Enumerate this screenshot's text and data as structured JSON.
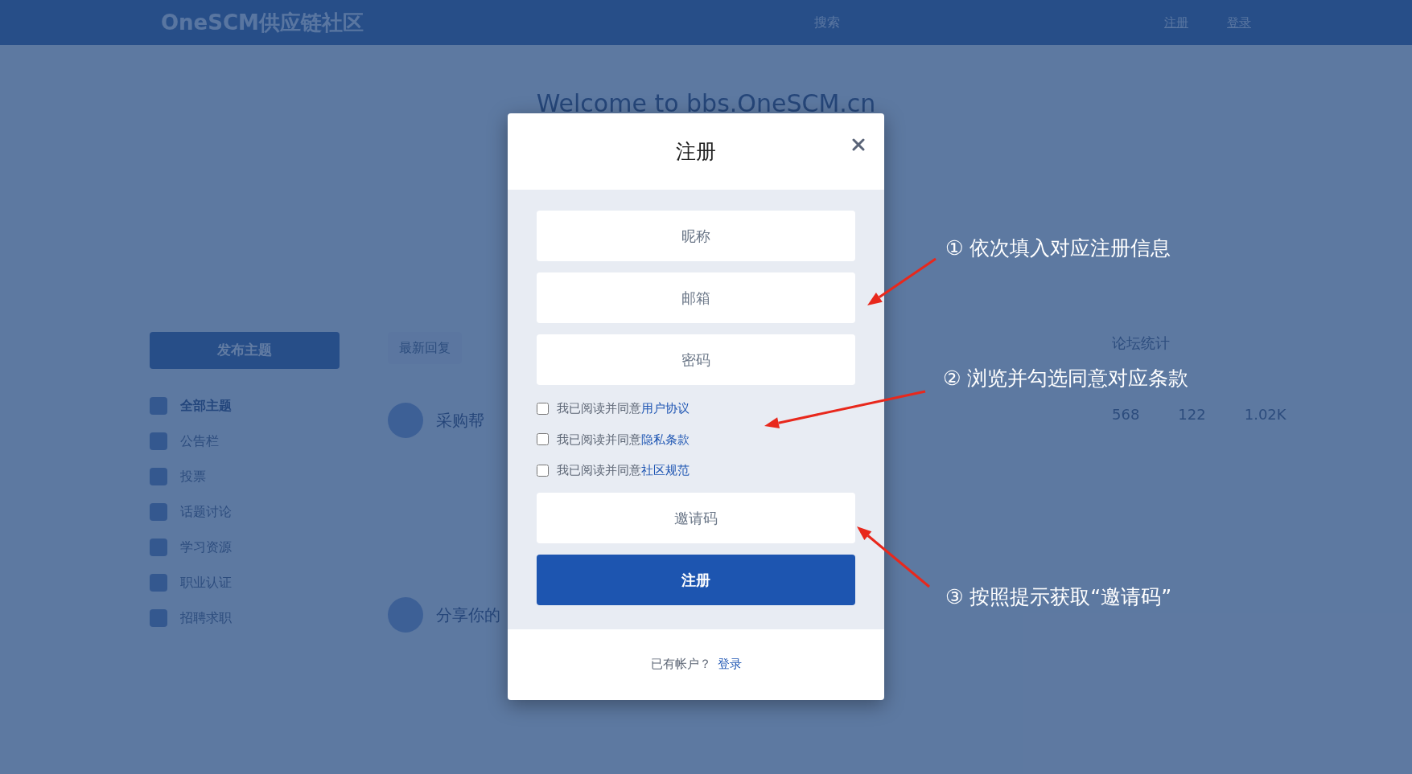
{
  "header": {
    "logo": "OneSCM供应链社区",
    "search_placeholder": "搜索",
    "links": [
      "注册",
      "登录"
    ]
  },
  "welcome": "Welcome to bbs.OneSCM.cn",
  "sidebar": {
    "post_button": "发布主题",
    "items": [
      {
        "label": "全部主题",
        "selected": true
      },
      {
        "label": "公告栏",
        "selected": false
      },
      {
        "label": "投票",
        "selected": false
      },
      {
        "label": "话题讨论",
        "selected": false
      },
      {
        "label": "学习资源",
        "selected": false
      },
      {
        "label": "职业认证",
        "selected": false
      },
      {
        "label": "招聘求职",
        "selected": false
      }
    ]
  },
  "sort_dropdown": "最新回复",
  "topics": [
    {
      "title": "采购帮"
    },
    {
      "title": "分享你的"
    }
  ],
  "stats": {
    "title": "论坛统计",
    "values": [
      "568",
      "122",
      "1.02K"
    ]
  },
  "modal": {
    "title": "注册",
    "fields": [
      {
        "placeholder": "昵称"
      },
      {
        "placeholder": "邮箱"
      },
      {
        "placeholder": "密码"
      }
    ],
    "agreements": [
      {
        "text": "我已阅读并同意",
        "link": "用户协议",
        "checked": false
      },
      {
        "text": "我已阅读并同意",
        "link": "隐私条款",
        "checked": false
      },
      {
        "text": "我已阅读并同意",
        "link": "社区规范",
        "checked": false
      }
    ],
    "invite": {
      "placeholder": "邀请码"
    },
    "submit": "注册",
    "footer_text": "已有帐户？",
    "footer_link": "登录"
  },
  "annotations": [
    {
      "text": "① 依次填入对应注册信息"
    },
    {
      "text": "② 浏览并勾选同意对应条款"
    },
    {
      "text": "③ 按照提示获取“邀请码”"
    }
  ]
}
